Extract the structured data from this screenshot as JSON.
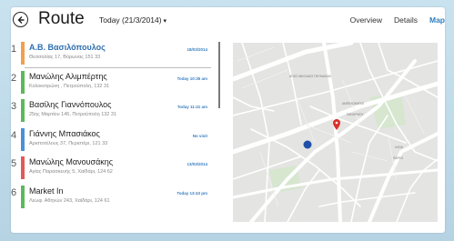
{
  "header": {
    "title": "Route",
    "date": "Today (21/3/2014)",
    "tabs": [
      {
        "label": "Overview",
        "active": false
      },
      {
        "label": "Details",
        "active": false
      },
      {
        "label": "Map",
        "active": true
      }
    ]
  },
  "colors": {
    "accent": "#2f7fc0",
    "bar_blue": "#4a90d9",
    "bar_orange": "#f0a050",
    "bar_green": "#5cb85c",
    "bar_red": "#e05a5a"
  },
  "stops": [
    {
      "num": "1",
      "name": "Α.Β. Βασιλόπουλος",
      "address": "Θεσσαλίας 17, Βύρωνας 151 33",
      "time": "18/03/2014",
      "color": "#f0a050",
      "selected": true
    },
    {
      "num": "2",
      "name": "Μανώλης Αλιμπέρτης",
      "address": "Κολοκοτρώνη , Πετρούπολη, 132 31",
      "time": "Today 10:35 am",
      "color": "#5cb85c",
      "selected": false
    },
    {
      "num": "3",
      "name": "Βασίλης Γιαννόπουλος",
      "address": "25ης Μαρτίου 145, Πετρούπολη 132 31",
      "time": "Today 11:41 am",
      "color": "#5cb85c",
      "selected": false
    },
    {
      "num": "4",
      "name": "Γιάννης Μπασιάκος",
      "address": "Αριστοτέλους 37, Περιστέρι, 121 33",
      "time": "No visit",
      "color": "#4a90d9",
      "selected": false
    },
    {
      "num": "5",
      "name": "Μανώλης Μανουσάκης",
      "address": "Αγίας Παρασκευής 5, Χαϊδάρι, 124 62",
      "time": "13/03/2014",
      "color": "#e05a5a",
      "selected": false
    },
    {
      "num": "6",
      "name": "Market In",
      "address": "Λεωφ. Αθηνών 243, Χαϊδάρι, 124 61",
      "time": "Today 13:43 pm",
      "color": "#5cb85c",
      "selected": false
    }
  ],
  "map": {
    "labels": [
      "ΑΓΙΟΣ ΝΙΚΟΛΑΟΣ ΠΕΥΚΑΚΙΩΝ",
      "ΑΜΠΕΛΟΚΗΠΟΙ",
      "ΠΑΝΟΡΜΟΥ",
      "ΙΛΙΣΙΑ",
      "ΠΑΡΚΟ"
    ],
    "pin_icon": "map-pin-icon",
    "location_icon": "current-location-icon"
  }
}
